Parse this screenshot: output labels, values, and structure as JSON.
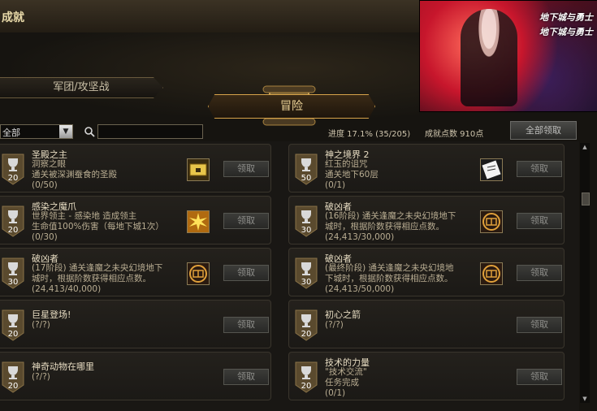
{
  "window": {
    "title": "成就"
  },
  "banner": {
    "logo_line1": "地下城与勇士",
    "logo_line2": "地下城与勇士"
  },
  "tabs": {
    "legion": "军团/攻坚战",
    "adventure": "冒险"
  },
  "toolbar": {
    "filter_value": "全部",
    "search_value": "",
    "progress": "进度  17.1% (35/205)",
    "points": "成就点数 910点",
    "claim_all": "全部领取"
  },
  "achievements": [
    {
      "name": "圣殿之主",
      "desc": "洞察之眼\n通关被深渊蚕食的圣殿",
      "progress": "(0/50)",
      "points": "20",
      "claim": "领取",
      "icon": "chest-icon"
    },
    {
      "name": "神之境界 2",
      "desc": "红玉的诅咒\n通关地下60层",
      "progress": "(0/1)",
      "points": "50",
      "claim": "领取",
      "icon": "scroll-paper-icon"
    },
    {
      "name": "感染之魔爪",
      "desc": "世界领主 - 感染地      造成领主\n生命值100%伤害（每地下城1次）",
      "progress": "(0/30)",
      "points": "20",
      "claim": "领取",
      "icon": "golden-burst-icon"
    },
    {
      "name": "破凶者",
      "desc": "(16阶段) 通关逢魔之未央幻境地下\n城时，根据阶数获得相应点数。",
      "progress": "(24,413/30,000)",
      "points": "30",
      "claim": "领取",
      "icon": "emblem-icon"
    },
    {
      "name": "破凶者",
      "desc": "(17阶段) 通关逢魔之未央幻境地下\n城时，根据阶数获得相应点数。",
      "progress": "(24,413/40,000)",
      "points": "30",
      "claim": "领取",
      "icon": "emblem-icon"
    },
    {
      "name": "破凶者",
      "desc": "(最终阶段) 通关逢魔之未央幻境地\n下城时，根据阶数获得相应点数。",
      "progress": "(24,413/50,000)",
      "points": "30",
      "claim": "领取",
      "icon": "emblem-icon"
    },
    {
      "name": "巨星登场!",
      "desc": "",
      "progress": "(?/?)",
      "points": "20",
      "claim": "领取",
      "icon": ""
    },
    {
      "name": "初心之箭",
      "desc": "",
      "progress": "(?/?)",
      "points": "20",
      "claim": "领取",
      "icon": ""
    },
    {
      "name": "神奇动物在哪里",
      "desc": "",
      "progress": "(?/?)",
      "points": "20",
      "claim": "领取",
      "icon": ""
    },
    {
      "name": "技术的力量",
      "desc": "\"技术交流\"\n任务完成",
      "progress": "(0/1)",
      "points": "20",
      "claim": "领取",
      "icon": ""
    }
  ],
  "colors": {
    "accent": "#d6a24a",
    "badge": "#5a4a2e",
    "text": "#d9d2bf"
  }
}
